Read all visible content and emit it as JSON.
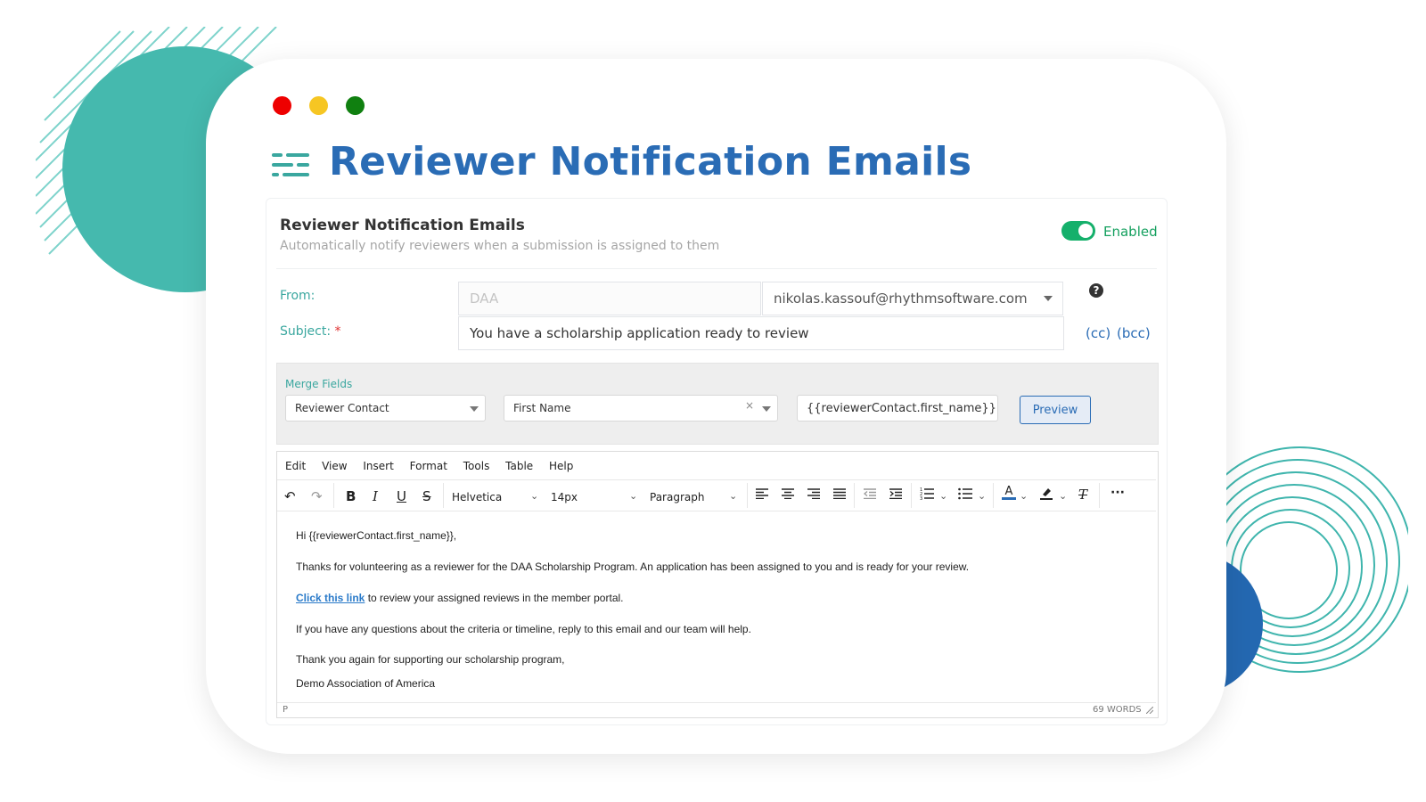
{
  "window": {
    "title": "Reviewer Notification Emails"
  },
  "section": {
    "title": "Reviewer Notification Emails",
    "subtitle": "Automatically notify reviewers when a submission is assigned to them",
    "toggle_label": "Enabled",
    "toggle_on": true
  },
  "form": {
    "from_label": "From:",
    "from_name_placeholder": "DAA",
    "from_email": "nikolas.kassouf@rhythmsoftware.com",
    "subject_label": "Subject:",
    "subject_required_mark": "*",
    "subject_value": "You have a scholarship application ready to review",
    "cc_label": "(cc)",
    "bcc_label": "(bcc)",
    "help_icon": "?"
  },
  "merge": {
    "label": "Merge Fields",
    "group_select": "Reviewer Contact",
    "field_select": "First Name",
    "clear_glyph": "×",
    "token": "{{reviewerContact.first_name}}",
    "preview_button": "Preview"
  },
  "editor": {
    "menu": [
      "Edit",
      "View",
      "Insert",
      "Format",
      "Tools",
      "Table",
      "Help"
    ],
    "font_family": "Helvetica",
    "font_size": "14px",
    "block_format": "Paragraph",
    "body": {
      "greeting": "Hi {{reviewerContact.first_name}},",
      "para1": "Thanks for volunteering as a reviewer for the DAA Scholarship Program. An application has been assigned to you and is ready for your review.",
      "link_text": "Click this link",
      "para2_rest": " to review your assigned reviews in the member portal.",
      "para3": "If you have any questions about the criteria or timeline, reply to this email and our team will help.",
      "closing": "Thank you again for supporting our scholarship program,",
      "signature": "Demo Association of America"
    },
    "status_path": "P",
    "word_count": "69 WORDS"
  },
  "colors": {
    "brand_blue": "#2a6cb5",
    "teal": "#3aa79f",
    "toggle_green": "#15b06b"
  }
}
